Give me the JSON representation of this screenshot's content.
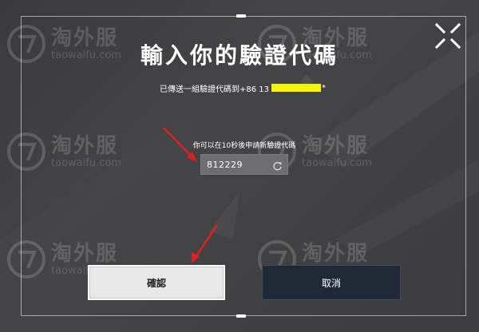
{
  "dialog": {
    "title": "輸入你的驗證代碼",
    "sent_prefix": "已傳送一組驗證代碼到+86 13",
    "sent_suffix": "*",
    "resend_hint": "你可以在10秒後申請新驗證代碼",
    "code_value": "812229",
    "confirm_label": "確認",
    "cancel_label": "取消"
  },
  "watermark": {
    "text": "淘外服",
    "url": "taowaifu.com"
  },
  "icons": {
    "close": "close-x-icon",
    "refresh": "refresh-icon",
    "logo": "watermark-logo-icon"
  },
  "colors": {
    "phone_redaction": "#f5f500",
    "arrow": "#e02020",
    "confirm_bg": "#e9e9e9",
    "cancel_bg": "#1f2a36"
  }
}
